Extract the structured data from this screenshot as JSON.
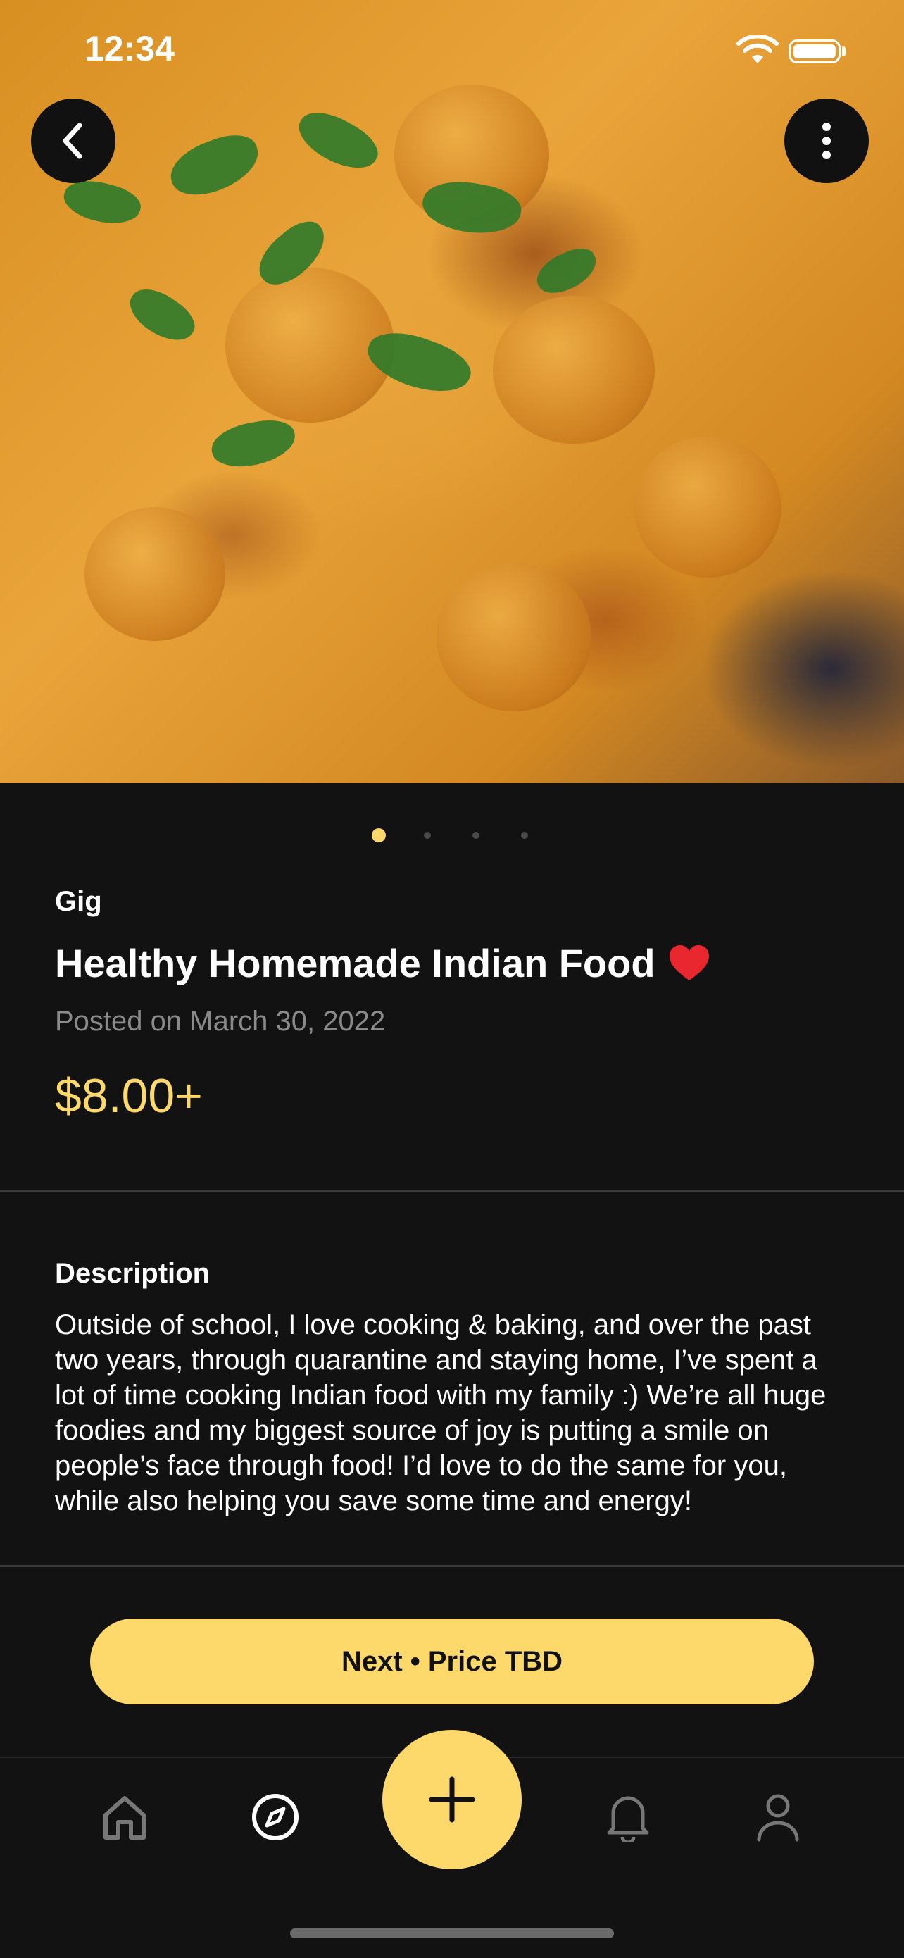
{
  "status_bar": {
    "time": "12:34"
  },
  "hero": {
    "image_description_icon": "food-photo",
    "page_count": 4,
    "active_page": 1
  },
  "listing": {
    "category": "Gig",
    "title": "Healthy Homemade Indian Food",
    "title_emoji_icon": "heart-icon",
    "posted": "Posted on March 30, 2022",
    "price": "$8.00+"
  },
  "description": {
    "label": "Description",
    "text": "Outside of school, I love cooking & baking, and over the past two years, through quarantine and staying home, I’ve spent a lot of time cooking Indian food with my family :) We’re all huge foodies and my biggest source of joy is putting a smile on people’s face through food! I’d love to do the same for you, while also helping you save some time and energy!"
  },
  "cta": {
    "label": "Next • Price TBD"
  },
  "tabbar": {
    "items": [
      "home-icon",
      "compass-icon",
      "plus-icon",
      "bell-icon",
      "person-icon"
    ],
    "active": "compass-icon"
  },
  "colors": {
    "accent": "#fdd86a",
    "background": "#121212",
    "muted": "#8a8a8a"
  }
}
